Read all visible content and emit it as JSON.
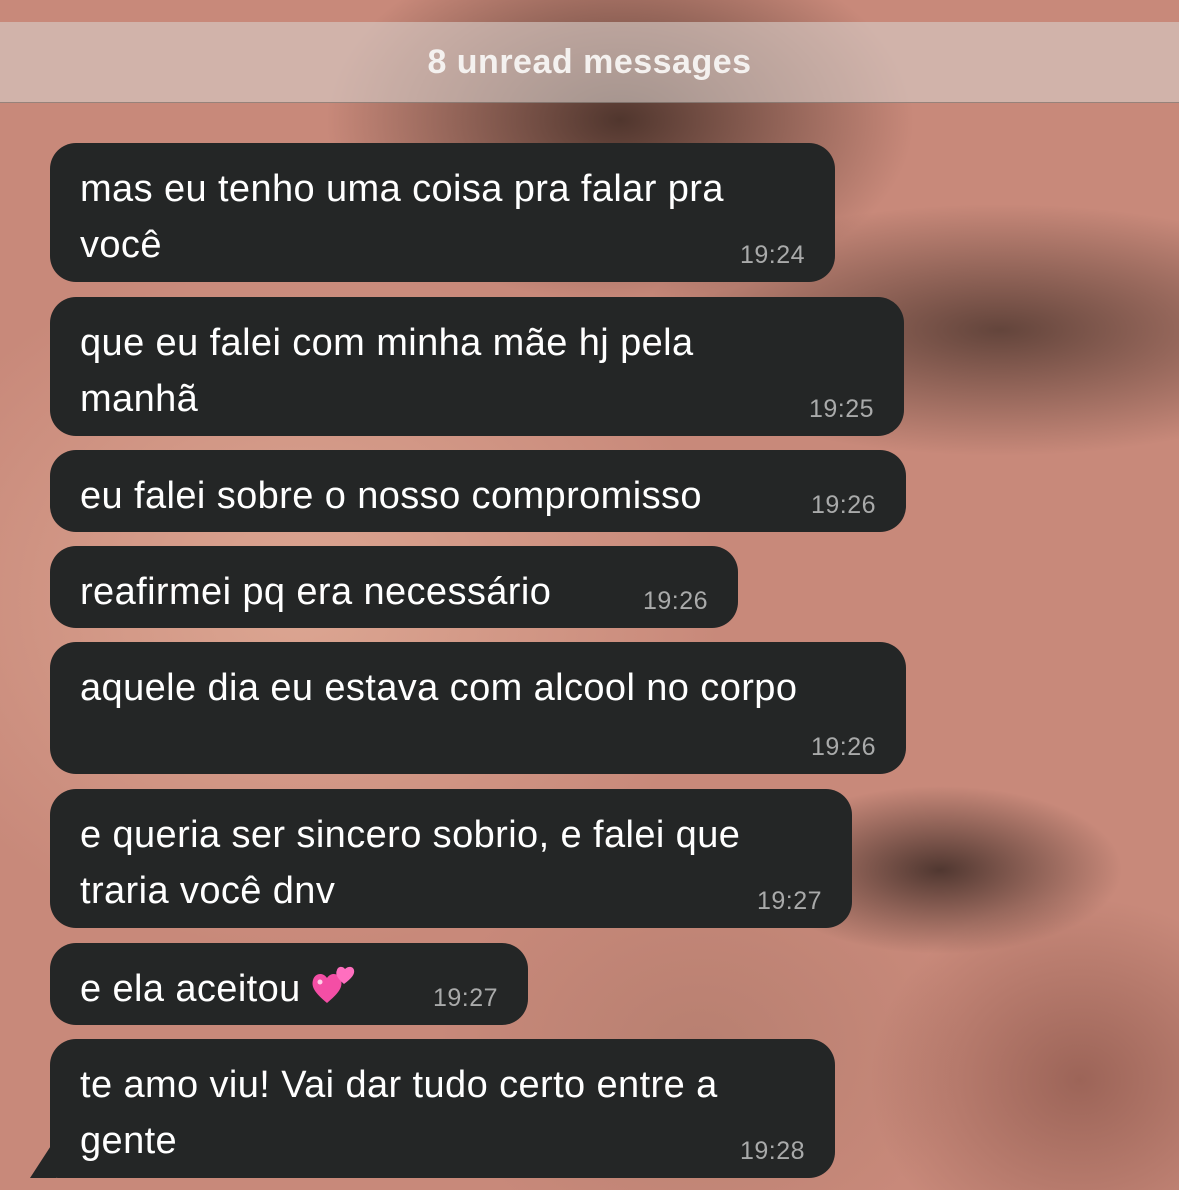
{
  "header": {
    "unread_label": "8 unread messages"
  },
  "messages": [
    {
      "text": "mas eu tenho uma coisa pra falar pra você",
      "time": "19:24"
    },
    {
      "text": "que eu falei com minha mãe hj pela manhã",
      "time": "19:25"
    },
    {
      "text": "eu falei sobre o nosso compromisso",
      "time": "19:26"
    },
    {
      "text": "reafirmei pq era necessário",
      "time": "19:26"
    },
    {
      "text": "aquele dia eu estava com alcool no corpo",
      "time": "19:26"
    },
    {
      "text": "e queria ser sincero sobrio, e falei que traria você dnv",
      "time": "19:27"
    },
    {
      "text": "e ela aceitou",
      "emoji": "two-hearts-emoji",
      "time": "19:27"
    },
    {
      "text": "te amo viu! Vai dar tudo certo entre a gente",
      "time": "19:28"
    }
  ],
  "colors": {
    "bubble": "#242626",
    "time": "#a9aaaa",
    "text": "#ffffff"
  }
}
